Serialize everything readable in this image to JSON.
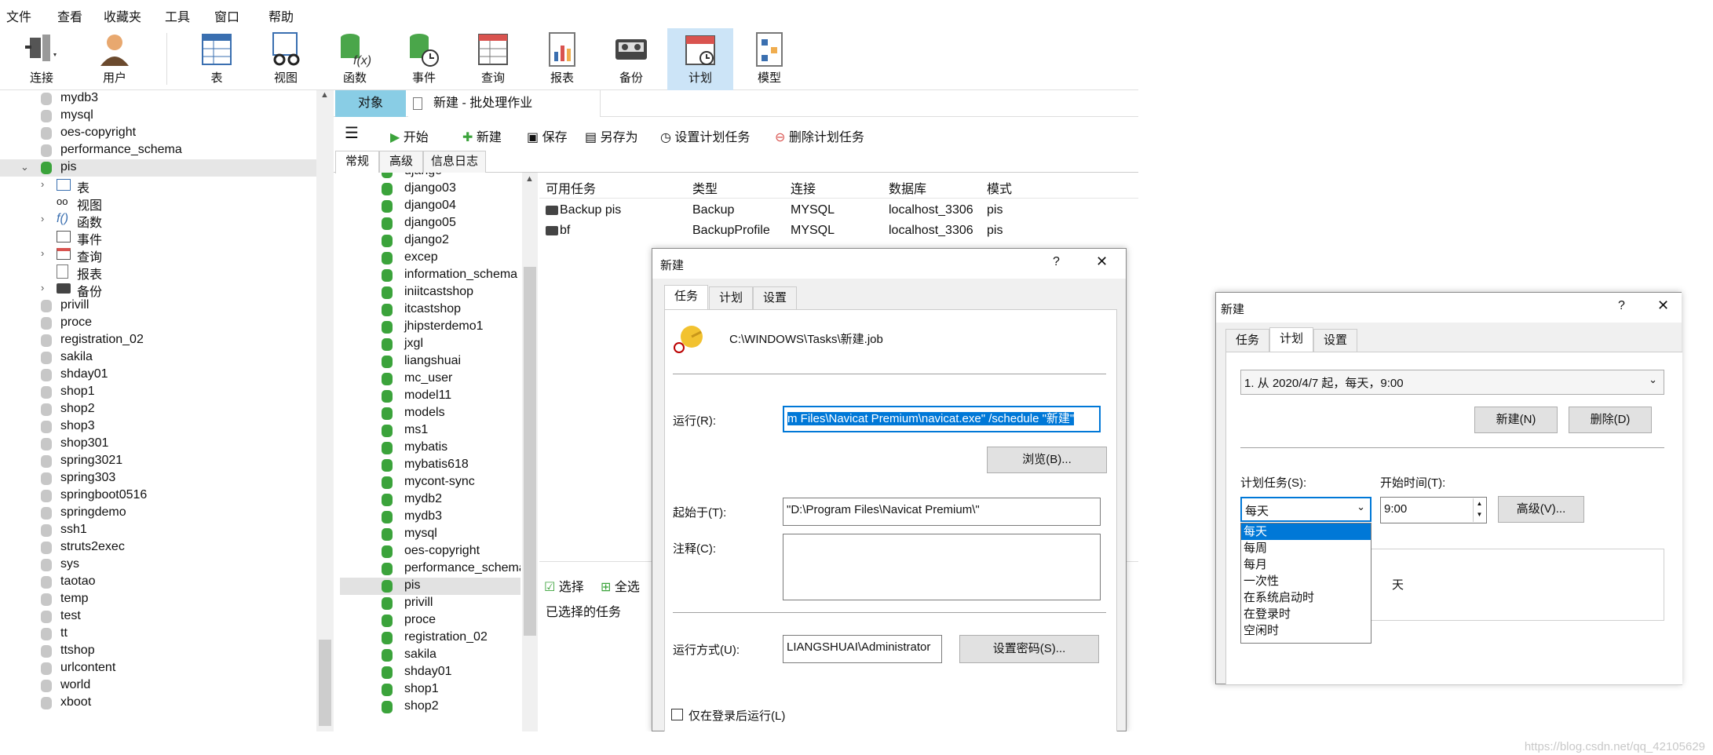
{
  "menu": [
    "文件",
    "查看",
    "收藏夹",
    "工具",
    "窗口",
    "帮助"
  ],
  "toolbar": [
    {
      "label": "连接",
      "icon": "connection-icon"
    },
    {
      "label": "用户",
      "icon": "user-icon"
    },
    {
      "label": "表",
      "icon": "table-icon"
    },
    {
      "label": "视图",
      "icon": "view-icon"
    },
    {
      "label": "函数",
      "icon": "function-icon"
    },
    {
      "label": "事件",
      "icon": "event-icon"
    },
    {
      "label": "查询",
      "icon": "query-icon"
    },
    {
      "label": "报表",
      "icon": "report-icon"
    },
    {
      "label": "备份",
      "icon": "backup-icon"
    },
    {
      "label": "计划",
      "icon": "schedule-icon",
      "active": true
    },
    {
      "label": "模型",
      "icon": "model-icon"
    }
  ],
  "left_tree": [
    "mydb3",
    "mysql",
    "oes-copyright",
    "performance_schema",
    "pis",
    "表",
    "视图",
    "函数",
    "事件",
    "查询",
    "报表",
    "备份",
    "privill",
    "proce",
    "registration_02",
    "sakila",
    "shday01",
    "shop1",
    "shop2",
    "shop3",
    "shop301",
    "spring3021",
    "spring303",
    "springboot0516",
    "springdemo",
    "ssh1",
    "struts2exec",
    "sys",
    "taotao",
    "temp",
    "test",
    "tt",
    "ttshop",
    "urlcontent",
    "world",
    "xboot"
  ],
  "tabs": {
    "object": "对象",
    "doc": "新建 - 批处理作业"
  },
  "actions": {
    "menu": "☰",
    "start": "开始",
    "new": "新建",
    "save": "保存",
    "saveas": "另存为",
    "set_schedule": "设置计划任务",
    "delete_schedule": "删除计划任务"
  },
  "subtabs": [
    "常规",
    "高级",
    "信息日志"
  ],
  "db_list": [
    "django",
    "django03",
    "django04",
    "django05",
    "django2",
    "excep",
    "information_schema",
    "iniitcastshop",
    "itcastshop",
    "jhipsterdemo1",
    "jxgl",
    "liangshuai",
    "mc_user",
    "model11",
    "models",
    "ms1",
    "mybatis",
    "mybatis618",
    "mycont-sync",
    "mydb2",
    "mydb3",
    "mysql",
    "oes-copyright",
    "performance_schema",
    "pis",
    "privill",
    "proce",
    "registration_02",
    "sakila",
    "shday01",
    "shop1",
    "shop2"
  ],
  "grid": {
    "headers": [
      "可用任务",
      "类型",
      "连接",
      "数据库",
      "模式"
    ],
    "rows": [
      [
        "Backup pis",
        "Backup",
        "MYSQL",
        "localhost_3306",
        "pis"
      ],
      [
        "bf",
        "BackupProfile",
        "MYSQL",
        "localhost_3306",
        "pis"
      ]
    ]
  },
  "bottom": {
    "select": "选择",
    "select_all": "全选",
    "selected_tasks": "已选择的任务"
  },
  "dialog1": {
    "title": "新建",
    "help": "?",
    "close": "✕",
    "tabs": [
      "任务",
      "计划",
      "设置"
    ],
    "path": "C:\\WINDOWS\\Tasks\\新建.job",
    "run_label": "运行(R):",
    "run_value": "m Files\\Navicat Premium\\navicat.exe\" /schedule \"新建\"",
    "browse": "浏览(B)...",
    "start_in_label": "起始于(T):",
    "start_in_value": "\"D:\\Program Files\\Navicat Premium\\\"",
    "comment_label": "注释(C):",
    "run_as_label": "运行方式(U):",
    "run_as_value": "LIANGSHUAI\\Administrator",
    "set_password": "设置密码(S)...",
    "only_logged": "仅在登录后运行(L)"
  },
  "dialog2": {
    "title": "新建",
    "help": "?",
    "close": "✕",
    "tabs": [
      "任务",
      "计划",
      "设置"
    ],
    "schedule_summary": "1. 从 2020/4/7 起，每天，9:00",
    "new_btn": "新建(N)",
    "delete_btn": "删除(D)",
    "schedule_task_label": "计划任务(S):",
    "start_time_label": "开始时间(T):",
    "selected": "每天",
    "time": "9:00",
    "advanced": "高级(V)...",
    "day_label": "天",
    "options": [
      "每天",
      "每周",
      "每月",
      "一次性",
      "在系统启动时",
      "在登录时",
      "空闲时"
    ]
  },
  "watermark": "https://blog.csdn.net/qq_42105629"
}
